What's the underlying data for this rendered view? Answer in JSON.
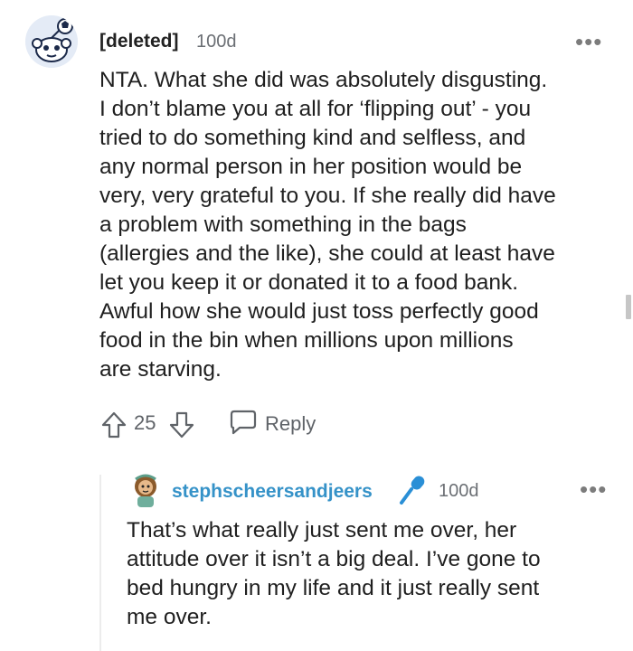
{
  "comment": {
    "author": "[deleted]",
    "age": "100d",
    "more_label": "•••",
    "body_lines": [
      "NTA. What she did was absolutely disgusting.",
      "I don’t blame you at all for ‘flipping out’ - you",
      "tried to do something kind and selfless, and",
      "any normal person in her position would be",
      "very, very grateful to you. If she really did have",
      "a problem with something in the bags",
      "(allergies and the like), she could at least have",
      "let you keep it or donated it to a food bank.",
      "Awful how she would just toss perfectly good",
      "food in the bin when millions upon millions",
      "are starving."
    ],
    "score": "25",
    "reply_label": "Reply",
    "icons": {
      "upvote": "upvote-arrow-icon",
      "downvote": "downvote-arrow-icon",
      "reply": "speech-bubble-icon",
      "avatar": "snoo-avatar-icon"
    }
  },
  "reply": {
    "author": "stephscheersandjeers",
    "age": "100d",
    "more_label": "•••",
    "flair_icon": "microphone-icon",
    "body_lines": [
      "That’s what really just sent me over, her",
      "attitude over it isn’t a big deal. I’ve gone to",
      "bed hungry in my life and it just really sent",
      "me over."
    ]
  },
  "colors": {
    "username_link": "#3592c8",
    "meta_gray": "#6b6f74",
    "text": "#1f1f1f"
  }
}
